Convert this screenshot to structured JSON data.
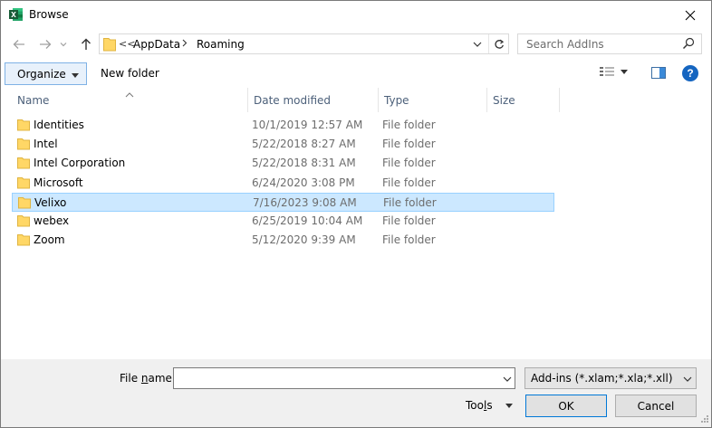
{
  "window": {
    "title": "Browse",
    "app_icon": "excel-icon",
    "close_icon": "close-icon"
  },
  "navigation": {
    "back_icon": "arrow-left-icon",
    "forward_icon": "arrow-right-icon",
    "recent_icon": "chevron-down-icon",
    "up_icon": "arrow-up-icon",
    "address": {
      "overflow": "<<",
      "crumbs": [
        "AppData",
        "Roaming"
      ],
      "folder_icon": "folder-icon",
      "dropdown_icon": "chevron-down-icon",
      "refresh_icon": "refresh-icon"
    },
    "search": {
      "placeholder": "Search AddIns",
      "icon": "search-icon"
    }
  },
  "toolbar": {
    "organize_label": "Organize",
    "new_folder_label": "New folder",
    "view_icon": "details-view-icon",
    "preview_icon": "preview-pane-icon",
    "help_label": "?"
  },
  "columns": {
    "name": "Name",
    "date_modified": "Date modified",
    "type": "Type",
    "size": "Size"
  },
  "files": [
    {
      "name": "Identities",
      "date": "10/1/2019 12:57 AM",
      "type": "File folder",
      "selected": false
    },
    {
      "name": "Intel",
      "date": "5/22/2018 8:27 AM",
      "type": "File folder",
      "selected": false
    },
    {
      "name": "Intel Corporation",
      "date": "5/22/2018 8:31 AM",
      "type": "File folder",
      "selected": false
    },
    {
      "name": "Microsoft",
      "date": "6/24/2020 3:08 PM",
      "type": "File folder",
      "selected": false
    },
    {
      "name": "Velixo",
      "date": "7/16/2023 9:08 AM",
      "type": "File folder",
      "selected": true
    },
    {
      "name": "webex",
      "date": "6/25/2019 10:04 AM",
      "type": "File folder",
      "selected": false
    },
    {
      "name": "Zoom",
      "date": "5/12/2020 9:39 AM",
      "type": "File folder",
      "selected": false
    }
  ],
  "footer": {
    "file_name_label_pre": "File ",
    "file_name_label_key": "n",
    "file_name_label_post": "ame:",
    "file_name_value": "",
    "file_type": "Add-ins (*.xlam;*.xla;*.xll)",
    "tools_pre": "Too",
    "tools_key": "l",
    "tools_post": "s",
    "ok_label": "OK",
    "cancel_label": "Cancel"
  },
  "colors": {
    "selection_bg": "#cce8ff",
    "selection_border": "#99d1ff",
    "folder": "#ffd766",
    "accent": "#0078d7"
  }
}
